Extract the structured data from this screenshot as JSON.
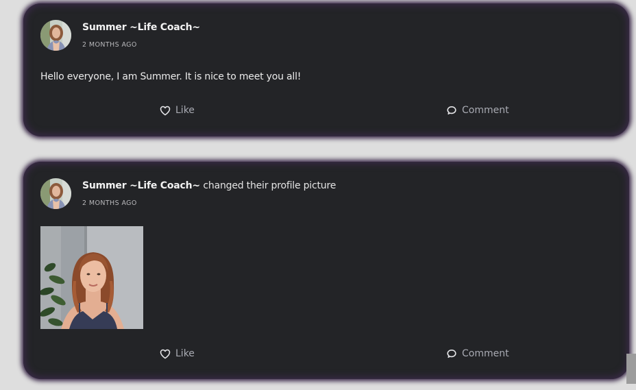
{
  "feed": {
    "posts": [
      {
        "author": "Summer ~Life Coach~",
        "action": "",
        "timestamp": "2 MONTHS AGO",
        "text": "Hello everyone, I am Summer. It is nice to meet you all!",
        "like_label": "Like",
        "comment_label": "Comment"
      },
      {
        "author": "Summer ~Life Coach~",
        "action": "changed their profile picture",
        "timestamp": "2 MONTHS AGO",
        "text": "",
        "like_label": "Like",
        "comment_label": "Comment"
      }
    ]
  },
  "icons": {
    "like": "heart-icon",
    "comment": "speech-bubble-icon"
  },
  "colors": {
    "page_background": "#dedede",
    "card_background": "#232427",
    "card_glow": "#3a2848",
    "action_text": "#a9abb3"
  }
}
